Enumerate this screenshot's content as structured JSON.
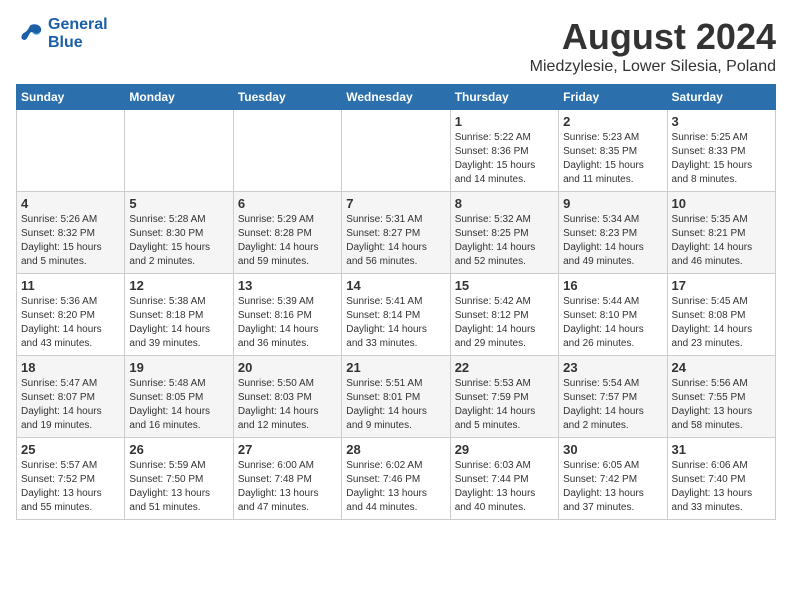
{
  "logo": {
    "line1": "General",
    "line2": "Blue"
  },
  "title": "August 2024",
  "subtitle": "Miedzylesie, Lower Silesia, Poland",
  "days_of_week": [
    "Sunday",
    "Monday",
    "Tuesday",
    "Wednesday",
    "Thursday",
    "Friday",
    "Saturday"
  ],
  "weeks": [
    [
      {
        "num": "",
        "info": ""
      },
      {
        "num": "",
        "info": ""
      },
      {
        "num": "",
        "info": ""
      },
      {
        "num": "",
        "info": ""
      },
      {
        "num": "1",
        "info": "Sunrise: 5:22 AM\nSunset: 8:36 PM\nDaylight: 15 hours\nand 14 minutes."
      },
      {
        "num": "2",
        "info": "Sunrise: 5:23 AM\nSunset: 8:35 PM\nDaylight: 15 hours\nand 11 minutes."
      },
      {
        "num": "3",
        "info": "Sunrise: 5:25 AM\nSunset: 8:33 PM\nDaylight: 15 hours\nand 8 minutes."
      }
    ],
    [
      {
        "num": "4",
        "info": "Sunrise: 5:26 AM\nSunset: 8:32 PM\nDaylight: 15 hours\nand 5 minutes."
      },
      {
        "num": "5",
        "info": "Sunrise: 5:28 AM\nSunset: 8:30 PM\nDaylight: 15 hours\nand 2 minutes."
      },
      {
        "num": "6",
        "info": "Sunrise: 5:29 AM\nSunset: 8:28 PM\nDaylight: 14 hours\nand 59 minutes."
      },
      {
        "num": "7",
        "info": "Sunrise: 5:31 AM\nSunset: 8:27 PM\nDaylight: 14 hours\nand 56 minutes."
      },
      {
        "num": "8",
        "info": "Sunrise: 5:32 AM\nSunset: 8:25 PM\nDaylight: 14 hours\nand 52 minutes."
      },
      {
        "num": "9",
        "info": "Sunrise: 5:34 AM\nSunset: 8:23 PM\nDaylight: 14 hours\nand 49 minutes."
      },
      {
        "num": "10",
        "info": "Sunrise: 5:35 AM\nSunset: 8:21 PM\nDaylight: 14 hours\nand 46 minutes."
      }
    ],
    [
      {
        "num": "11",
        "info": "Sunrise: 5:36 AM\nSunset: 8:20 PM\nDaylight: 14 hours\nand 43 minutes."
      },
      {
        "num": "12",
        "info": "Sunrise: 5:38 AM\nSunset: 8:18 PM\nDaylight: 14 hours\nand 39 minutes."
      },
      {
        "num": "13",
        "info": "Sunrise: 5:39 AM\nSunset: 8:16 PM\nDaylight: 14 hours\nand 36 minutes."
      },
      {
        "num": "14",
        "info": "Sunrise: 5:41 AM\nSunset: 8:14 PM\nDaylight: 14 hours\nand 33 minutes."
      },
      {
        "num": "15",
        "info": "Sunrise: 5:42 AM\nSunset: 8:12 PM\nDaylight: 14 hours\nand 29 minutes."
      },
      {
        "num": "16",
        "info": "Sunrise: 5:44 AM\nSunset: 8:10 PM\nDaylight: 14 hours\nand 26 minutes."
      },
      {
        "num": "17",
        "info": "Sunrise: 5:45 AM\nSunset: 8:08 PM\nDaylight: 14 hours\nand 23 minutes."
      }
    ],
    [
      {
        "num": "18",
        "info": "Sunrise: 5:47 AM\nSunset: 8:07 PM\nDaylight: 14 hours\nand 19 minutes."
      },
      {
        "num": "19",
        "info": "Sunrise: 5:48 AM\nSunset: 8:05 PM\nDaylight: 14 hours\nand 16 minutes."
      },
      {
        "num": "20",
        "info": "Sunrise: 5:50 AM\nSunset: 8:03 PM\nDaylight: 14 hours\nand 12 minutes."
      },
      {
        "num": "21",
        "info": "Sunrise: 5:51 AM\nSunset: 8:01 PM\nDaylight: 14 hours\nand 9 minutes."
      },
      {
        "num": "22",
        "info": "Sunrise: 5:53 AM\nSunset: 7:59 PM\nDaylight: 14 hours\nand 5 minutes."
      },
      {
        "num": "23",
        "info": "Sunrise: 5:54 AM\nSunset: 7:57 PM\nDaylight: 14 hours\nand 2 minutes."
      },
      {
        "num": "24",
        "info": "Sunrise: 5:56 AM\nSunset: 7:55 PM\nDaylight: 13 hours\nand 58 minutes."
      }
    ],
    [
      {
        "num": "25",
        "info": "Sunrise: 5:57 AM\nSunset: 7:52 PM\nDaylight: 13 hours\nand 55 minutes."
      },
      {
        "num": "26",
        "info": "Sunrise: 5:59 AM\nSunset: 7:50 PM\nDaylight: 13 hours\nand 51 minutes."
      },
      {
        "num": "27",
        "info": "Sunrise: 6:00 AM\nSunset: 7:48 PM\nDaylight: 13 hours\nand 47 minutes."
      },
      {
        "num": "28",
        "info": "Sunrise: 6:02 AM\nSunset: 7:46 PM\nDaylight: 13 hours\nand 44 minutes."
      },
      {
        "num": "29",
        "info": "Sunrise: 6:03 AM\nSunset: 7:44 PM\nDaylight: 13 hours\nand 40 minutes."
      },
      {
        "num": "30",
        "info": "Sunrise: 6:05 AM\nSunset: 7:42 PM\nDaylight: 13 hours\nand 37 minutes."
      },
      {
        "num": "31",
        "info": "Sunrise: 6:06 AM\nSunset: 7:40 PM\nDaylight: 13 hours\nand 33 minutes."
      }
    ]
  ]
}
